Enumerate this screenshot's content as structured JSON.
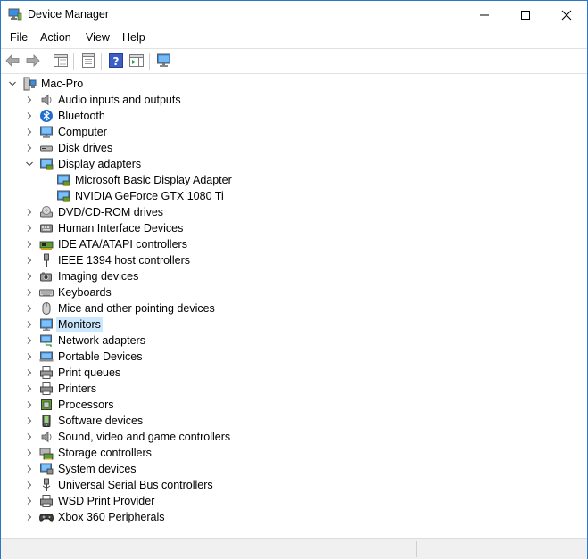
{
  "window": {
    "title": "Device Manager"
  },
  "menu": [
    "File",
    "Action",
    "View",
    "Help"
  ],
  "tree": {
    "root": "Mac-Pro",
    "categories": [
      {
        "label": "Audio inputs and outputs",
        "icon": "speaker-icon"
      },
      {
        "label": "Bluetooth",
        "icon": "bluetooth-icon"
      },
      {
        "label": "Computer",
        "icon": "computer-icon"
      },
      {
        "label": "Disk drives",
        "icon": "disk-drive-icon"
      },
      {
        "label": "Display adapters",
        "icon": "display-adapter-icon",
        "expanded": true,
        "children": [
          "Microsoft Basic Display Adapter",
          "NVIDIA GeForce GTX 1080 Ti"
        ]
      },
      {
        "label": "DVD/CD-ROM drives",
        "icon": "dvd-drive-icon"
      },
      {
        "label": "Human Interface Devices",
        "icon": "hid-icon"
      },
      {
        "label": "IDE ATA/ATAPI controllers",
        "icon": "ide-controller-icon"
      },
      {
        "label": "IEEE 1394 host controllers",
        "icon": "ieee1394-icon"
      },
      {
        "label": "Imaging devices",
        "icon": "camera-icon"
      },
      {
        "label": "Keyboards",
        "icon": "keyboard-icon"
      },
      {
        "label": "Mice and other pointing devices",
        "icon": "mouse-icon"
      },
      {
        "label": "Monitors",
        "icon": "monitor-icon",
        "selected": true
      },
      {
        "label": "Network adapters",
        "icon": "network-adapter-icon"
      },
      {
        "label": "Portable Devices",
        "icon": "portable-device-icon"
      },
      {
        "label": "Print queues",
        "icon": "print-queue-icon"
      },
      {
        "label": "Printers",
        "icon": "printer-icon"
      },
      {
        "label": "Processors",
        "icon": "processor-icon"
      },
      {
        "label": "Software devices",
        "icon": "software-device-icon"
      },
      {
        "label": "Sound, video and game controllers",
        "icon": "sound-controller-icon"
      },
      {
        "label": "Storage controllers",
        "icon": "storage-controller-icon"
      },
      {
        "label": "System devices",
        "icon": "system-device-icon"
      },
      {
        "label": "Universal Serial Bus controllers",
        "icon": "usb-icon"
      },
      {
        "label": "WSD Print Provider",
        "icon": "wsd-printer-icon"
      },
      {
        "label": "Xbox 360 Peripherals",
        "icon": "gamepad-icon"
      }
    ]
  },
  "colors": {
    "selection": "#cce8ff",
    "accent": "#2b78c9"
  }
}
